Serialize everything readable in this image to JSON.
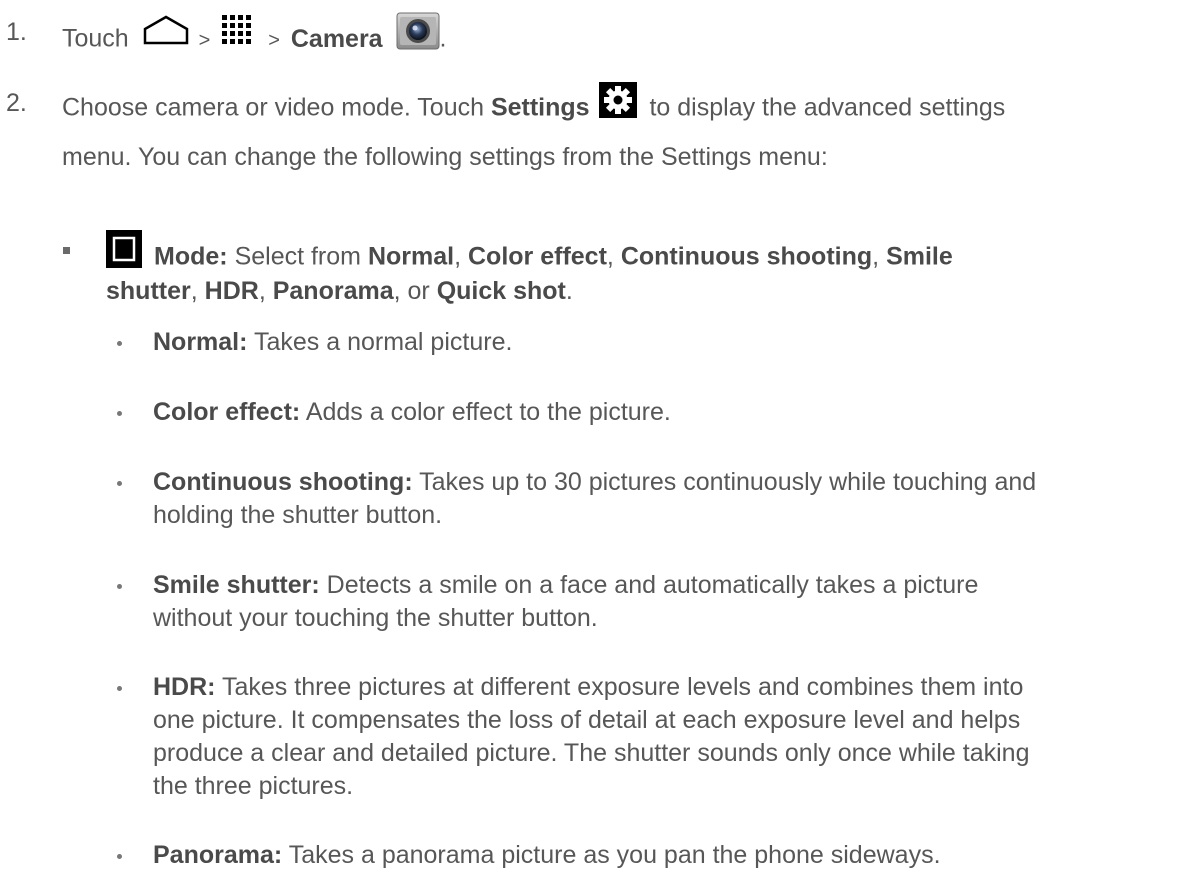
{
  "step1": {
    "number": "1.",
    "pre": "Touch",
    "sep1": ">",
    "sep2": ">",
    "camera": "Camera",
    "end": ".",
    "icons": [
      "home-icon",
      "apps-grid-icon",
      "camera-app-icon"
    ]
  },
  "step2": {
    "number": "2.",
    "l1_pre": "Choose camera or video mode. Touch",
    "settings": "Settings",
    "l1_post": "to display the advanced settings",
    "l2": "menu. You can change the following settings from the Settings menu:",
    "icon": "gear-icon"
  },
  "mode": {
    "icon": "mode-square-icon",
    "label": "Mode:",
    "pre": "Select from",
    "options": [
      "Normal",
      "Color effect",
      "Continuous shooting",
      "Smile",
      "shutter",
      "HDR",
      "Panorama",
      "Quick shot"
    ],
    "sep_comma": ",",
    "or": ", or",
    "end": "."
  },
  "items": [
    {
      "label": "Normal:",
      "lines": [
        "Takes a normal picture."
      ]
    },
    {
      "label": "Color effect:",
      "lines": [
        "Adds a color effect to the picture."
      ]
    },
    {
      "label": "Continuous shooting:",
      "lines": [
        "Takes up to 30 pictures continuously while touching and",
        "holding the shutter button."
      ]
    },
    {
      "label": "Smile shutter:",
      "lines": [
        "Detects a smile on a face and automatically takes a picture",
        "without your touching the shutter button."
      ]
    },
    {
      "label": "HDR:",
      "lines": [
        "Takes three pictures at different exposure levels and combines them into",
        "one picture. It compensates the loss of detail at each exposure level and helps",
        "produce a clear and detailed picture. The shutter sounds only once while taking",
        "the three pictures."
      ]
    },
    {
      "label": "Panorama:",
      "lines": [
        "Takes a panorama picture as you pan the phone sideways."
      ]
    }
  ]
}
